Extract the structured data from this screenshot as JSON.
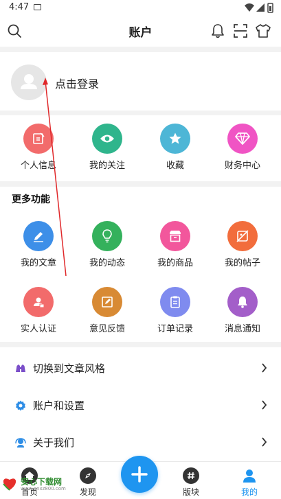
{
  "status_bar": {
    "time": "4:47"
  },
  "header": {
    "title": "账户"
  },
  "login": {
    "label": "点击登录"
  },
  "quick": [
    {
      "label": "个人信息",
      "color": "#f26b6b",
      "icon": "edit-square-icon"
    },
    {
      "label": "我的关注",
      "color": "#2fb58c",
      "icon": "eye-icon"
    },
    {
      "label": "收藏",
      "color": "#4db6d6",
      "icon": "star-icon"
    },
    {
      "label": "财务中心",
      "color": "#f054c4",
      "icon": "diamond-icon"
    }
  ],
  "more": {
    "title": "更多功能",
    "items": [
      {
        "label": "我的文章",
        "color": "#3d8fe8",
        "icon": "pencil-icon"
      },
      {
        "label": "我的动态",
        "color": "#34b15c",
        "icon": "bulb-icon"
      },
      {
        "label": "我的商品",
        "color": "#f2579c",
        "icon": "shop-icon"
      },
      {
        "label": "我的帖子",
        "color": "#f26d3c",
        "icon": "post-off-icon"
      },
      {
        "label": "实人认证",
        "color": "#f26b6b",
        "icon": "id-card-icon"
      },
      {
        "label": "意见反馈",
        "color": "#d88a34",
        "icon": "feedback-icon"
      },
      {
        "label": "订单记录",
        "color": "#7f8bef",
        "icon": "clipboard-icon"
      },
      {
        "label": "消息通知",
        "color": "#a35ec9",
        "icon": "bell-icon"
      }
    ]
  },
  "menu": [
    {
      "label": "切换到文章风格",
      "icon": "binoculars-icon",
      "color": "#7b4fc9"
    },
    {
      "label": "账户和设置",
      "icon": "gear-icon",
      "color": "#2d8de6"
    },
    {
      "label": "关于我们",
      "icon": "support-icon",
      "color": "#2d8de6"
    }
  ],
  "tabbar": {
    "tabs": [
      {
        "label": "首页",
        "icon": "home-icon"
      },
      {
        "label": "发现",
        "icon": "compass-icon"
      },
      {
        "label": "版块",
        "icon": "hashtag-icon"
      },
      {
        "label": "我的",
        "icon": "user-icon"
      }
    ],
    "active_color": "#1e95f0"
  },
  "watermark": {
    "name": "安心下载网",
    "url": "www.anxz800.com"
  }
}
